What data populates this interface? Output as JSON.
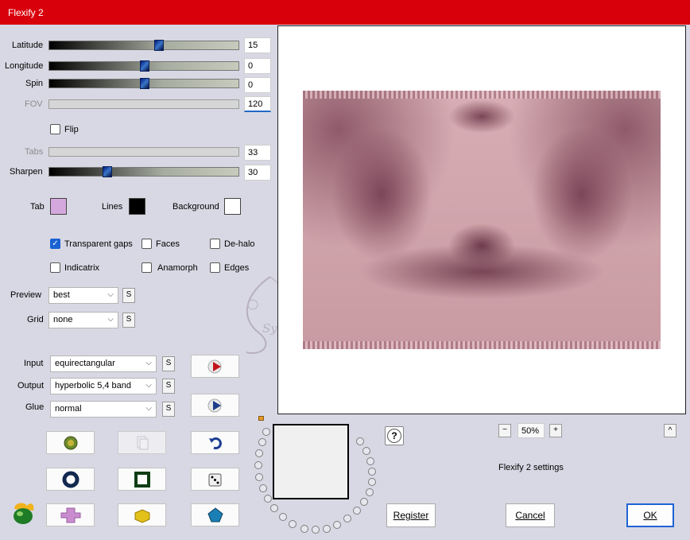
{
  "window": {
    "title": "Flexify 2"
  },
  "sliders": [
    {
      "label": "Latitude",
      "value": "15",
      "enabled": true,
      "level": 0.58
    },
    {
      "label": "Longitude",
      "value": "0",
      "enabled": true,
      "level": 0.5
    },
    {
      "label": "Spin",
      "value": "0",
      "enabled": true,
      "level": 0.5
    },
    {
      "label": "FOV",
      "value": "120",
      "enabled": false,
      "level": 0
    },
    {
      "label": "Tabs",
      "value": "33",
      "enabled": false,
      "level": 0
    },
    {
      "label": "Sharpen",
      "value": "30",
      "enabled": true,
      "level": 0.3
    }
  ],
  "flip": {
    "label": "Flip",
    "checked": false
  },
  "colors": {
    "tab": {
      "label": "Tab",
      "value": "#d5a8dd"
    },
    "lines": {
      "label": "Lines",
      "value": "#000000"
    },
    "background": {
      "label": "Background",
      "value": "#ffffff"
    }
  },
  "checkboxes": {
    "transparent_gaps": {
      "label": "Transparent gaps",
      "checked": true
    },
    "faces": {
      "label": "Faces",
      "checked": false
    },
    "de_halo": {
      "label": "De-halo",
      "checked": false
    },
    "indicatrix": {
      "label": "Indicatrix",
      "checked": false
    },
    "anamorph": {
      "label": "Anamorph",
      "checked": false
    },
    "edges": {
      "label": "Edges",
      "checked": false
    }
  },
  "preview": {
    "label": "Preview",
    "value": "best"
  },
  "grid": {
    "label": "Grid",
    "value": "none"
  },
  "input": {
    "label": "Input",
    "value": "equirectangular"
  },
  "output": {
    "label": "Output",
    "value": "hyperbolic 5,4 band"
  },
  "glue": {
    "label": "Glue",
    "value": "normal"
  },
  "s_label": "S",
  "watermark": "Sylviane",
  "zoom": {
    "value": "50%",
    "minus": "−",
    "plus": "+",
    "collapse": "^"
  },
  "help": "?",
  "settings_label": "Flexify 2 settings",
  "buttons": {
    "register": "Register",
    "cancel": "Cancel",
    "ok": "OK"
  }
}
